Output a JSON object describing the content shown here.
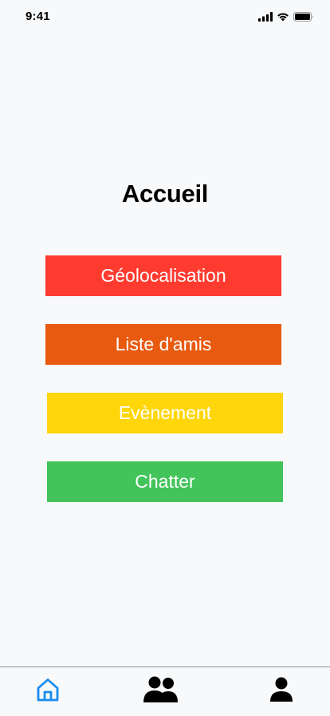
{
  "status_bar": {
    "time": "9:41",
    "icons": [
      "signal-icon",
      "wifi-icon",
      "battery-icon"
    ]
  },
  "page": {
    "title": "Accueil"
  },
  "menu": {
    "buttons": [
      {
        "label": "Géolocalisation",
        "color": "#ff3b30"
      },
      {
        "label": "Liste d'amis",
        "color": "#e85a0f"
      },
      {
        "label": "Evènement",
        "color": "#ffd60a"
      },
      {
        "label": "Chatter",
        "color": "#43c45a"
      }
    ]
  },
  "tab_bar": {
    "tabs": [
      {
        "icon": "home-icon",
        "active": true,
        "color": "#1a8cf0"
      },
      {
        "icon": "friends-icon",
        "active": false,
        "color": "#000000"
      },
      {
        "icon": "profile-icon",
        "active": false,
        "color": "#000000"
      }
    ]
  }
}
